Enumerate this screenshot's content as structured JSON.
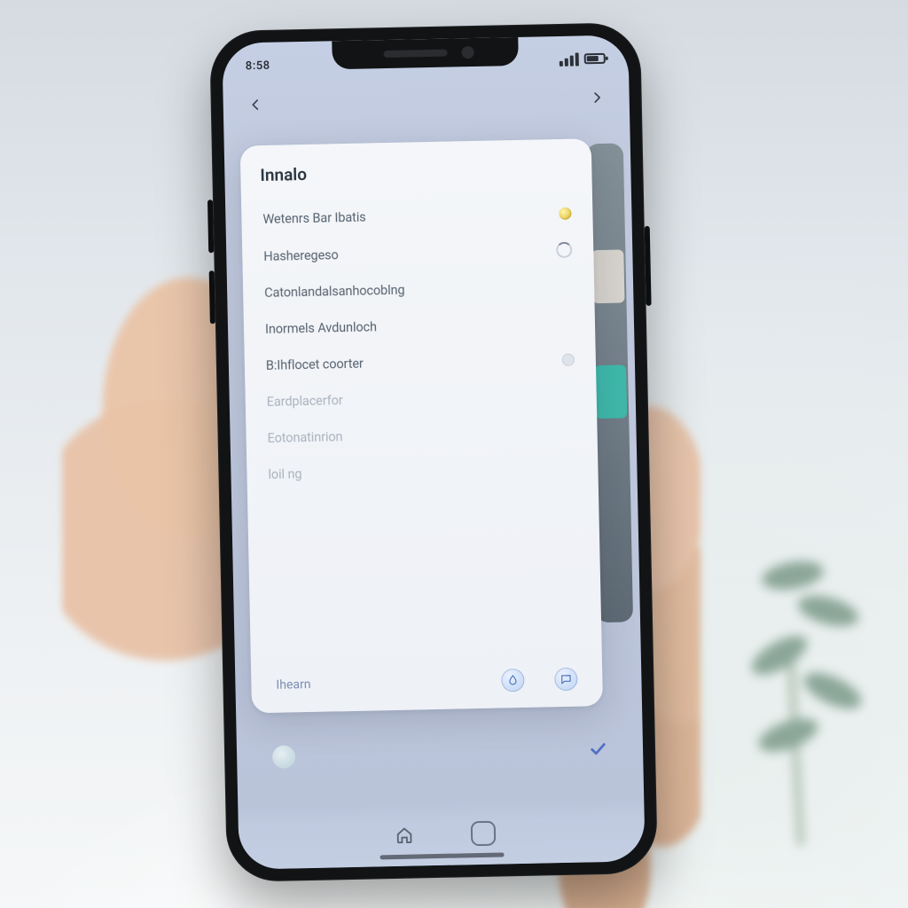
{
  "status": {
    "time": "8:58",
    "network": "●●●"
  },
  "header": {
    "back_icon": "back-arrow",
    "action_icon": "share"
  },
  "sheet": {
    "title": "Innalo",
    "items": [
      {
        "label": "Wetenrs Bar Ibatis",
        "indicator": "yellow",
        "dim": false
      },
      {
        "label": "Hasheregeso",
        "indicator": "spinner",
        "dim": false
      },
      {
        "label": "Catonlandalsanhocoblng",
        "indicator": "none",
        "dim": false
      },
      {
        "label": "Inormels Avdunloch",
        "indicator": "none",
        "dim": false
      },
      {
        "label": "B:Ihflocet coorter",
        "indicator": "grey",
        "dim": false
      },
      {
        "label": "Eardplacerfor",
        "indicator": "none",
        "dim": true
      },
      {
        "label": "Eotonatinrion",
        "indicator": "none",
        "dim": true
      },
      {
        "label": "loil ng",
        "indicator": "none",
        "dim": true
      }
    ],
    "footer_label": "Ihearn",
    "footer_icons": [
      "drop-icon",
      "chat-icon"
    ]
  },
  "under": {
    "left_icon": "globe-icon",
    "right_icon": "check-icon"
  },
  "nav": {
    "home_icon": "home",
    "recent_icon": "recent"
  }
}
